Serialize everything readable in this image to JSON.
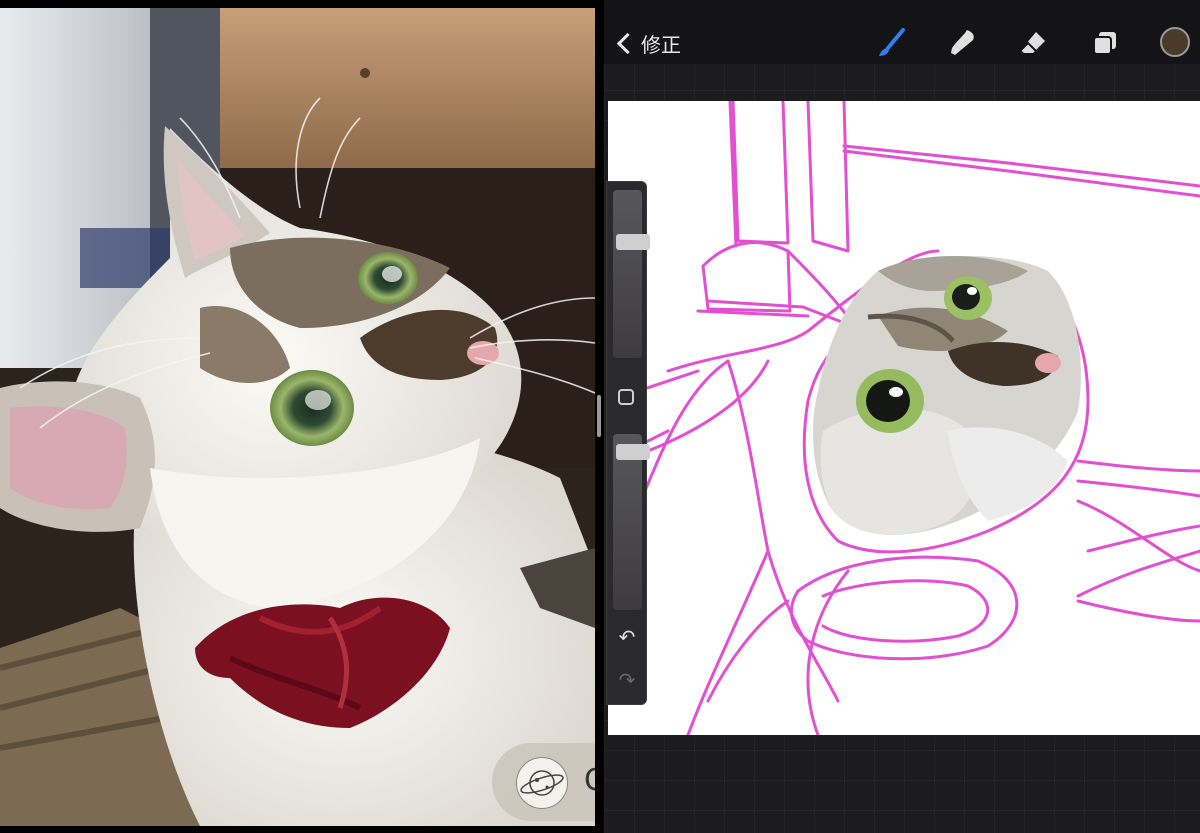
{
  "left_pane": {
    "gallery_button": {
      "letter": "G",
      "avatar_icon": "planet-sketch-icon"
    }
  },
  "procreate": {
    "back_label": "修正",
    "back_icon": "chevron-left-icon",
    "tools": [
      {
        "name": "brush",
        "icon": "brush-icon",
        "active": true,
        "color": "#2f7ef6"
      },
      {
        "name": "smudge",
        "icon": "smudge-icon",
        "active": false,
        "color": "#e0e0e0"
      },
      {
        "name": "eraser",
        "icon": "eraser-icon",
        "active": false,
        "color": "#e0e0e0"
      },
      {
        "name": "layers",
        "icon": "layers-icon",
        "active": false,
        "color": "#e0e0e0"
      }
    ],
    "current_color": "#4a3a28",
    "sidebar": {
      "brush_size_level": 0.29,
      "opacity_level": 0.06,
      "undo_icon": "undo-icon",
      "redo_icon": "redo-icon"
    }
  }
}
